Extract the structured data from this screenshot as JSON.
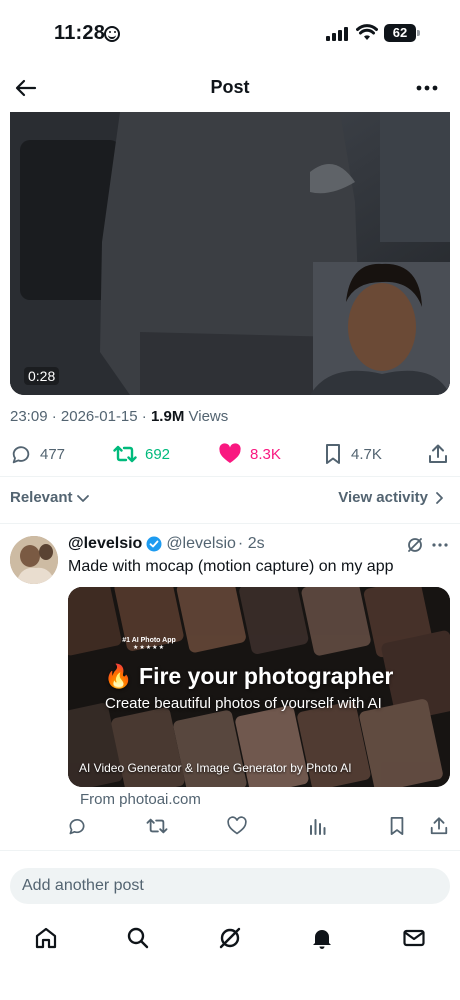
{
  "status_bar": {
    "time": "11:28",
    "battery": "62"
  },
  "header": {
    "title": "Post"
  },
  "video": {
    "duration": "0:28"
  },
  "post_meta": {
    "time": "23:09",
    "date": "2026-01-15",
    "views_count": "1.9M",
    "views_label": "Views"
  },
  "actions": {
    "replies": "477",
    "reposts": "692",
    "likes": "8.3K",
    "bookmarks": "4.7K"
  },
  "replies_header": {
    "sort_label": "Relevant",
    "view_activity_label": "View activity"
  },
  "reply": {
    "name": "@levelsio",
    "handle": "@levelsio",
    "time": "· 2s",
    "text": "Made with mocap (motion capture) on my app",
    "card": {
      "badge_line1": "#1 AI Photo App",
      "badge_stars": "★★★★★",
      "title": "🔥 Fire your photographer",
      "subtitle": "Create beautiful photos of yourself with AI",
      "caption": "AI Video Generator & Image Generator by Photo AI"
    },
    "link_source": "From photoai.com"
  },
  "composer": {
    "placeholder": "Add another post"
  },
  "colors": {
    "accent_blue": "#1d9bf0",
    "repost_green": "#00ba7c",
    "like_pink": "#f91880",
    "secondary_text": "#536471"
  },
  "icons": [
    "back-arrow-icon",
    "more-icon",
    "reply-icon",
    "repost-icon",
    "heart-icon",
    "bookmark-icon",
    "share-icon",
    "chevron-down-icon",
    "chevron-right-icon",
    "verified-badge-icon",
    "grok-icon",
    "analytics-icon",
    "home-icon",
    "search-icon",
    "notifications-icon",
    "messages-icon"
  ]
}
